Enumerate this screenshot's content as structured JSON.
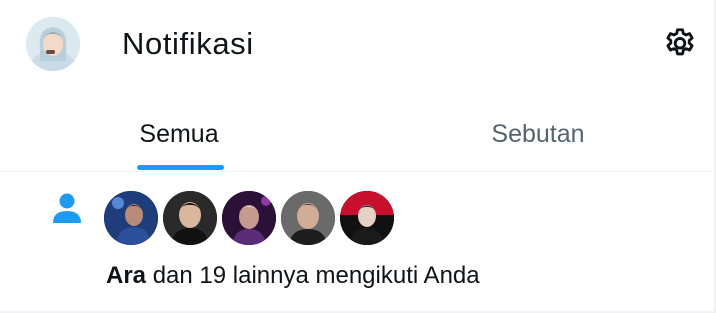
{
  "header": {
    "title": "Notifikasi",
    "avatar_icon": "user-avatar",
    "settings_icon": "gear-icon"
  },
  "tabs": [
    {
      "label": "Semua",
      "active": true
    },
    {
      "label": "Sebutan",
      "active": false
    }
  ],
  "notifications": [
    {
      "type": "follow",
      "icon": "person-icon",
      "avatars_count_shown": 5,
      "name": "Ara",
      "text": " dan 19 lainnya mengikuti Anda"
    }
  ],
  "colors": {
    "accent": "#1d9bf0",
    "text_primary": "#0f1419",
    "text_secondary": "#536471",
    "border": "#eff3f4"
  }
}
